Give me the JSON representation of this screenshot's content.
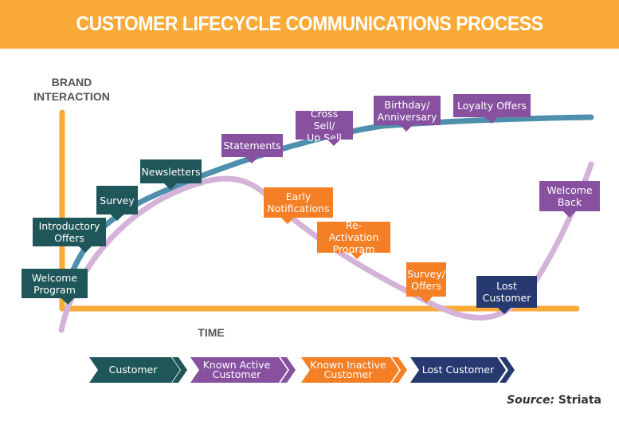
{
  "title": "CUSTOMER LIFECYCLE COMMUNICATIONS PROCESS",
  "axes": {
    "y_label_line1": "BRAND",
    "y_label_line2": "INTERACTION",
    "x_label": "TIME"
  },
  "colors": {
    "header": "#f9aa38",
    "axis": "#f9aa38",
    "engaged_curve": "#4f8fae",
    "lifecycle_curve": "#d4b3d9",
    "teal": "#1f5659",
    "purple": "#8751a0",
    "orange": "#f47f24",
    "navy": "#263a70"
  },
  "callouts": [
    {
      "id": "welcome-program",
      "lines": [
        "Welcome",
        "Program"
      ],
      "color": "teal"
    },
    {
      "id": "introductory-offers",
      "lines": [
        "Introductory",
        "Offers"
      ],
      "color": "teal"
    },
    {
      "id": "survey",
      "lines": [
        "Survey"
      ],
      "color": "teal"
    },
    {
      "id": "newsletters",
      "lines": [
        "Newsletters"
      ],
      "color": "teal"
    },
    {
      "id": "statements",
      "lines": [
        "Statements"
      ],
      "color": "purple"
    },
    {
      "id": "cross-sell",
      "lines": [
        "Cross Sell/",
        "Up Sell"
      ],
      "color": "purple"
    },
    {
      "id": "birthday",
      "lines": [
        "Birthday/",
        "Anniversary"
      ],
      "color": "purple"
    },
    {
      "id": "loyalty-offers",
      "lines": [
        "Loyalty Offers"
      ],
      "color": "purple"
    },
    {
      "id": "early-notifications",
      "lines": [
        "Early",
        "Notifications"
      ],
      "color": "orange"
    },
    {
      "id": "re-activation",
      "lines": [
        "Re-Activation",
        "Program"
      ],
      "color": "orange"
    },
    {
      "id": "survey-offers",
      "lines": [
        "Survey/",
        "Offers"
      ],
      "color": "orange"
    },
    {
      "id": "lost-customer",
      "lines": [
        "Lost",
        "Customer"
      ],
      "color": "navy"
    },
    {
      "id": "welcome-back",
      "lines": [
        "Welcome",
        "Back"
      ],
      "color": "purple"
    }
  ],
  "stages": [
    {
      "lines": [
        "Customer"
      ],
      "color": "teal"
    },
    {
      "lines": [
        "Known Active",
        "Customer"
      ],
      "color": "purple"
    },
    {
      "lines": [
        "Known Inactive",
        "Customer"
      ],
      "color": "orange"
    },
    {
      "lines": [
        "Lost Customer"
      ],
      "color": "navy"
    }
  ],
  "source": {
    "label": "Source:",
    "value": "Striata"
  }
}
